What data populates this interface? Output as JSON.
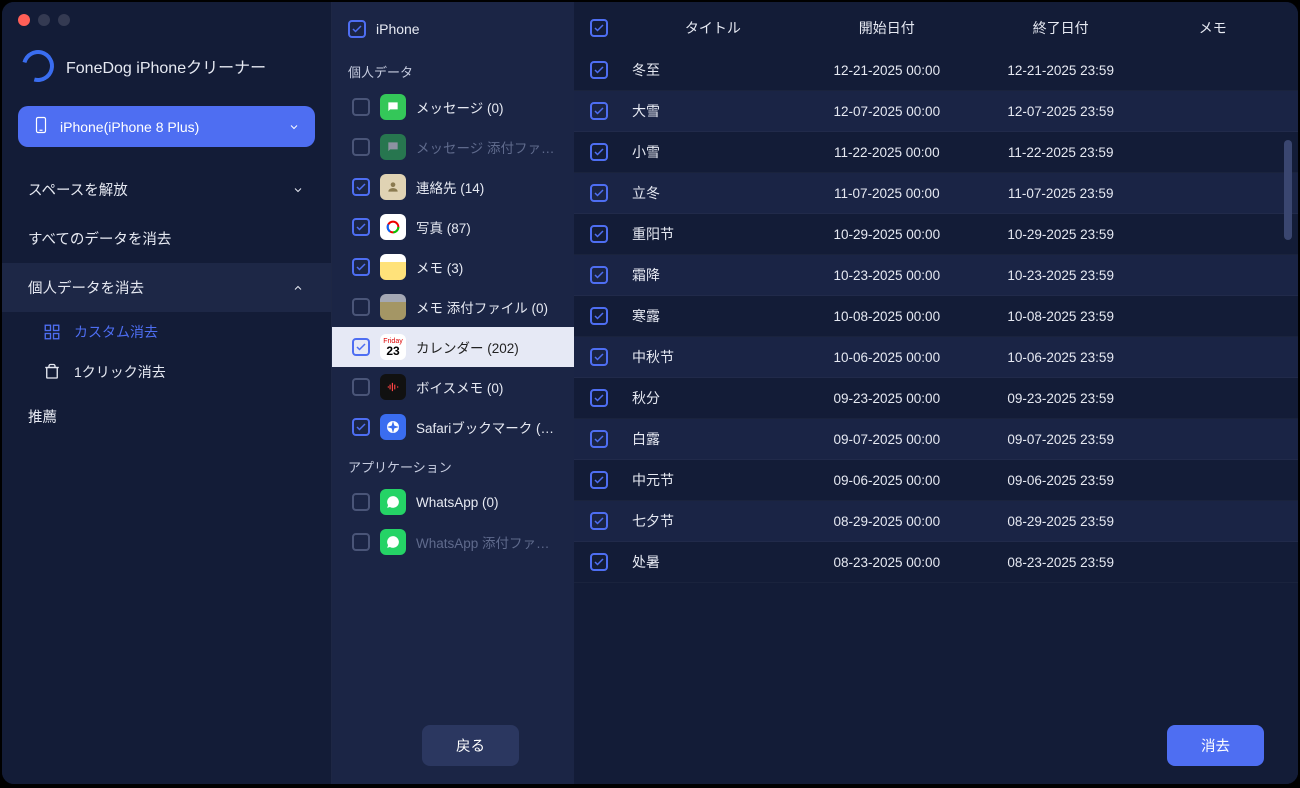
{
  "brand": {
    "title": "FoneDog iPhoneクリーナー"
  },
  "device": {
    "label": "iPhone(iPhone 8 Plus)"
  },
  "nav": {
    "free_space": "スペースを解放",
    "erase_all": "すべてのデータを消去",
    "erase_private": "個人データを消去",
    "custom_erase": "カスタム消去",
    "one_click_erase": "1クリック消去",
    "recommend": "推薦"
  },
  "categories": {
    "header": "iPhone",
    "section_personal": "個人データ",
    "section_app": "アプリケーション",
    "items": [
      {
        "label": "メッセージ (0)",
        "checked": false,
        "icon": "ic-msg",
        "disabled": false
      },
      {
        "label": "メッセージ 添付ファ…",
        "checked": false,
        "icon": "ic-msg2",
        "disabled": true
      },
      {
        "label": "連絡先 (14)",
        "checked": true,
        "icon": "ic-contacts",
        "disabled": false
      },
      {
        "label": "写真 (87)",
        "checked": true,
        "icon": "ic-photos",
        "disabled": false
      },
      {
        "label": "メモ (3)",
        "checked": true,
        "icon": "ic-notes",
        "disabled": false
      },
      {
        "label": "メモ 添付ファイル (0)",
        "checked": false,
        "icon": "ic-notes2",
        "disabled": false
      },
      {
        "label": "カレンダー (202)",
        "checked": true,
        "icon": "ic-cal",
        "disabled": false,
        "selected": true
      },
      {
        "label": "ボイスメモ (0)",
        "checked": false,
        "icon": "ic-voice",
        "disabled": false
      },
      {
        "label": "Safariブックマーク (…",
        "checked": true,
        "icon": "ic-safari",
        "disabled": false
      }
    ],
    "app_items": [
      {
        "label": "WhatsApp (0)",
        "checked": false,
        "icon": "ic-wa",
        "disabled": false
      },
      {
        "label": "WhatsApp 添付ファ…",
        "checked": false,
        "icon": "ic-wa",
        "disabled": true
      }
    ]
  },
  "table": {
    "cols": {
      "title": "タイトル",
      "start": "開始日付",
      "end": "終了日付",
      "memo": "メモ"
    },
    "rows": [
      {
        "title": "冬至",
        "start": "12-21-2025 00:00",
        "end": "12-21-2025 23:59",
        "memo": ""
      },
      {
        "title": "大雪",
        "start": "12-07-2025 00:00",
        "end": "12-07-2025 23:59",
        "memo": ""
      },
      {
        "title": "小雪",
        "start": "11-22-2025 00:00",
        "end": "11-22-2025 23:59",
        "memo": ""
      },
      {
        "title": "立冬",
        "start": "11-07-2025 00:00",
        "end": "11-07-2025 23:59",
        "memo": ""
      },
      {
        "title": "重阳节",
        "start": "10-29-2025 00:00",
        "end": "10-29-2025 23:59",
        "memo": ""
      },
      {
        "title": "霜降",
        "start": "10-23-2025 00:00",
        "end": "10-23-2025 23:59",
        "memo": ""
      },
      {
        "title": "寒露",
        "start": "10-08-2025 00:00",
        "end": "10-08-2025 23:59",
        "memo": ""
      },
      {
        "title": "中秋节",
        "start": "10-06-2025 00:00",
        "end": "10-06-2025 23:59",
        "memo": ""
      },
      {
        "title": "秋分",
        "start": "09-23-2025 00:00",
        "end": "09-23-2025 23:59",
        "memo": ""
      },
      {
        "title": "白露",
        "start": "09-07-2025 00:00",
        "end": "09-07-2025 23:59",
        "memo": ""
      },
      {
        "title": "中元节",
        "start": "09-06-2025 00:00",
        "end": "09-06-2025 23:59",
        "memo": ""
      },
      {
        "title": "七夕节",
        "start": "08-29-2025 00:00",
        "end": "08-29-2025 23:59",
        "memo": ""
      },
      {
        "title": "处暑",
        "start": "08-23-2025 00:00",
        "end": "08-23-2025 23:59",
        "memo": ""
      }
    ]
  },
  "buttons": {
    "back": "戻る",
    "erase": "消去"
  },
  "cal_icon": {
    "top": "Friday",
    "day": "23"
  }
}
